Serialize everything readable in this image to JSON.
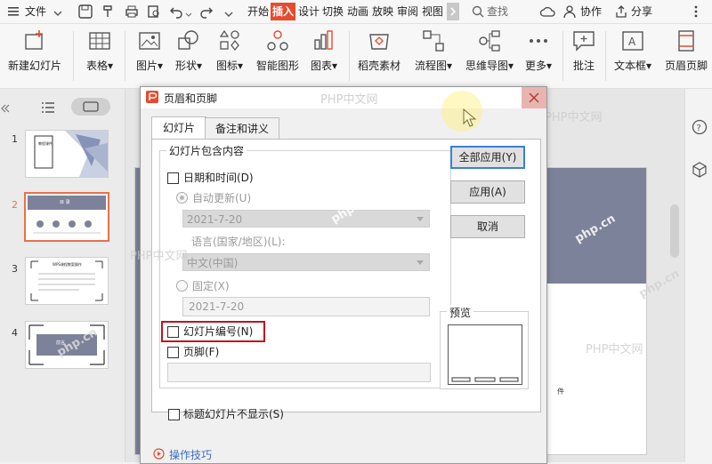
{
  "menubar": {
    "file_label": "文件",
    "tabs": [
      "开始",
      "插入",
      "设计",
      "切换",
      "动画",
      "放映",
      "审阅",
      "视图"
    ],
    "active_tab": "插入",
    "search_label": "查找",
    "collab_label": "协作",
    "share_label": "分享"
  },
  "ribbon": {
    "new_slide": "新建幻灯片",
    "table": "表格",
    "picture": "图片",
    "shape": "形状",
    "icon": "图标",
    "smartart": "智能图形",
    "chart": "图表",
    "shell_material": "稻壳素材",
    "flowchart": "流程图",
    "mindmap": "思维导图",
    "more": "更多",
    "comment": "批注",
    "textbox": "文本框",
    "header_footer": "页眉页脚"
  },
  "slides": [
    {
      "number": "1",
      "title": "教程课件"
    },
    {
      "number": "2",
      "title": "目 录"
    },
    {
      "number": "3",
      "title": "WPS课程教案操作"
    },
    {
      "number": "4",
      "title": "前言"
    }
  ],
  "dialog": {
    "title": "页眉和页脚",
    "tabs": [
      "幻灯片",
      "备注和讲义"
    ],
    "group_title": "幻灯片包含内容",
    "date_time": "日期和时间(D)",
    "auto_update": "自动更新(U)",
    "auto_date_value": "2021-7-20",
    "language_label": "语言(国家/地区)(L):",
    "language_value": "中文(中国)",
    "fixed": "固定(X)",
    "fixed_date_value": "2021-7-20",
    "slide_number": "幻灯片编号(N)",
    "footer": "页脚(F)",
    "hide_title_slide": "标题幻灯片不显示(S)",
    "preview_label": "预览",
    "apply_all": "全部应用(Y)",
    "apply": "应用(A)",
    "cancel": "取消",
    "tips_link": "操作技巧"
  },
  "slide_footer_text": "件",
  "watermarks": [
    "PHP中文网",
    "PHP中文网",
    "PHP中文网",
    "PHP中文网",
    "php.cn",
    "php.cn",
    "php.cn",
    "php.cn"
  ],
  "colors": {
    "accent": "#e84a2f",
    "slide_bg": "#7c8299",
    "highlight_box": "#c0141c"
  }
}
